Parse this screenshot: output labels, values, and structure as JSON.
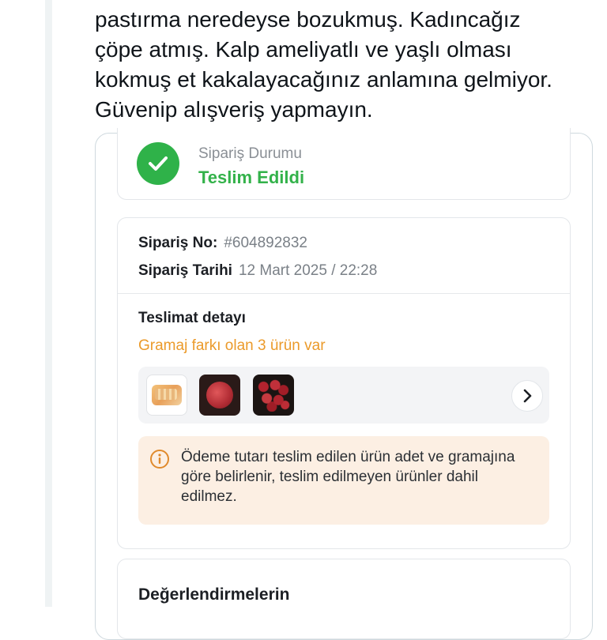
{
  "tweet": {
    "lines": [
      "pastırma neredeyse bozukmuş. Kadıncağız",
      "çöpe atmış. Kalp ameliyatlı ve yaşlı olması",
      "kokmuş et kakalayacağınız anlamına gelmiyor.",
      "Güvenip alışveriş yapmayın."
    ]
  },
  "order_status": {
    "label": "Sipariş Durumu",
    "value": "Teslim Edildi",
    "icon": "check-circle-icon",
    "color": "#33b24a"
  },
  "order_info": {
    "number_label": "Sipariş No:",
    "number_value": "#604892832",
    "date_label": "Sipariş Tarihi",
    "date_value": "12 Mart 2025 / 22:28"
  },
  "delivery": {
    "title": "Teslimat detayı",
    "gramaj_note": "Gramaj farkı olan 3 ürün var",
    "gramaj_color": "#eb9a2a",
    "products": [
      {
        "name": "product-thumb-pastirma"
      },
      {
        "name": "product-thumb-kiyma"
      },
      {
        "name": "product-thumb-kusbasi"
      }
    ],
    "notice": "Ödeme tutarı teslim edilen ürün adet ve gramajına göre belirlenir, teslim edilmeyen ürünler dahil edilmez."
  },
  "reviews": {
    "title": "Değerlendirmelerin"
  }
}
